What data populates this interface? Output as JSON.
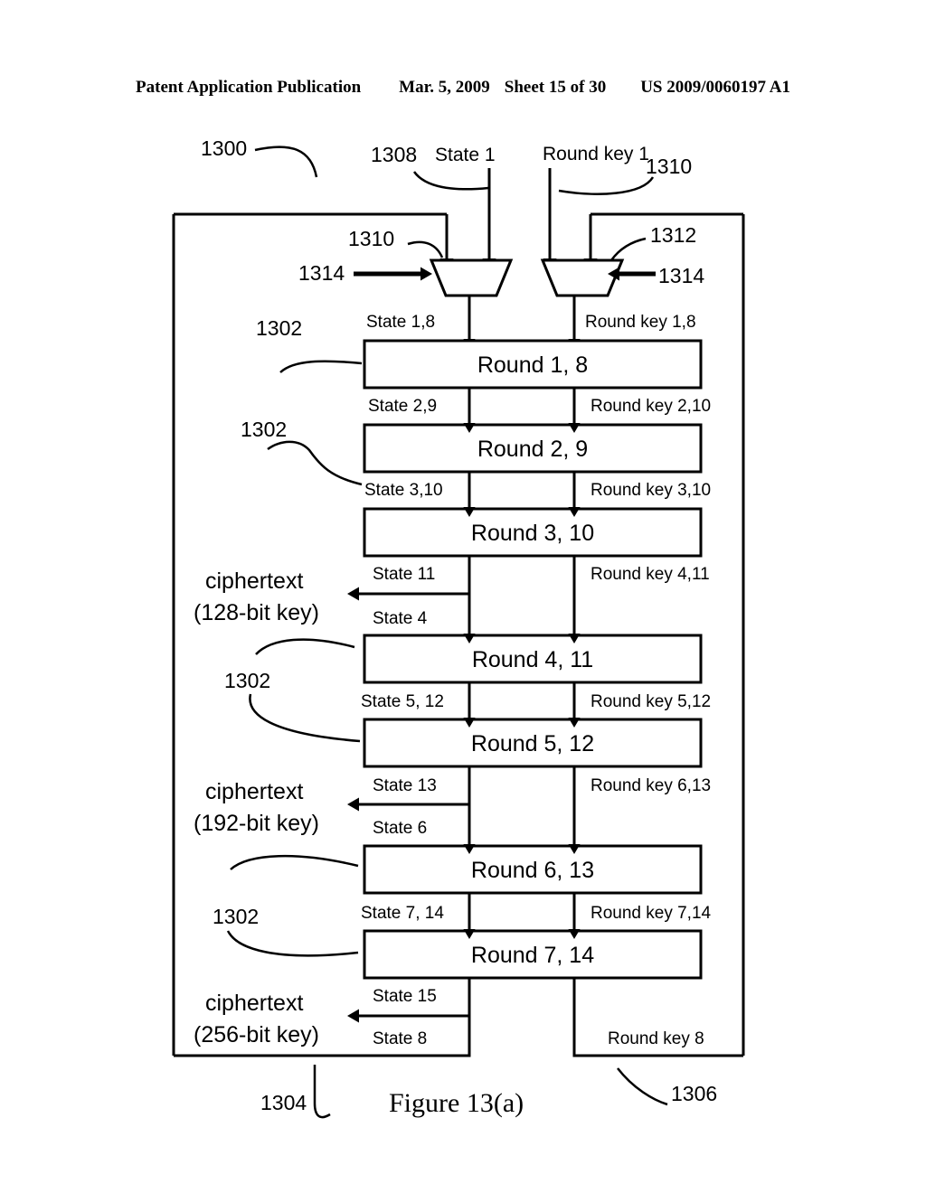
{
  "header": {
    "publication": "Patent Application Publication",
    "date": "Mar. 5, 2009",
    "sheet": "Sheet 15 of 30",
    "patent_number": "US 2009/0060197 A1"
  },
  "figure": {
    "caption": "Figure 13(a)",
    "reference_numerals": {
      "diagram": "1300",
      "state_input": "1308",
      "roundkey_input_a": "1310",
      "mux_left": "1310",
      "mux_right": "1312",
      "mux_select_left": "1314",
      "mux_select_right": "1314",
      "round_block_1": "1302",
      "round_block_2": "1302",
      "round_block_3": "1302",
      "round_block_4": "1302",
      "state_feedback": "1304",
      "roundkey_feedback": "1306"
    },
    "inputs": {
      "state": "State 1",
      "round_key": "Round key 1"
    },
    "rounds": [
      {
        "label": "Round 1, 8",
        "state_in": "State 1,8",
        "key_in": "Round key 1,8"
      },
      {
        "label": "Round 2, 9",
        "state_in": "State 2,9",
        "key_in": "Round key 2,10"
      },
      {
        "label": "Round 3, 10",
        "state_in": "State 3,10",
        "key_in": "Round key 3,10"
      },
      {
        "label": "Round 4, 11",
        "state_in": "State 4",
        "key_in": "Round key 4,11"
      },
      {
        "label": "Round 5, 12",
        "state_in": "State 5, 12",
        "key_in": "Round key 5,12"
      },
      {
        "label": "Round 6, 13",
        "state_in": "State 6",
        "key_in": "Round key 6,13"
      },
      {
        "label": "Round 7, 14",
        "state_in": "State 7, 14",
        "key_in": "Round key 7,14"
      }
    ],
    "taps": [
      {
        "state_label": "State 11",
        "ciphertext_line1": "ciphertext",
        "ciphertext_line2": "(128-bit key)"
      },
      {
        "state_label": "State 13",
        "ciphertext_line1": "ciphertext",
        "ciphertext_line2": "(192-bit key)"
      },
      {
        "state_label": "State 15",
        "ciphertext_line1": "ciphertext",
        "ciphertext_line2": "(256-bit key)"
      }
    ],
    "feedback": {
      "state_label": "State 8",
      "roundkey_label": "Round key 8"
    }
  }
}
